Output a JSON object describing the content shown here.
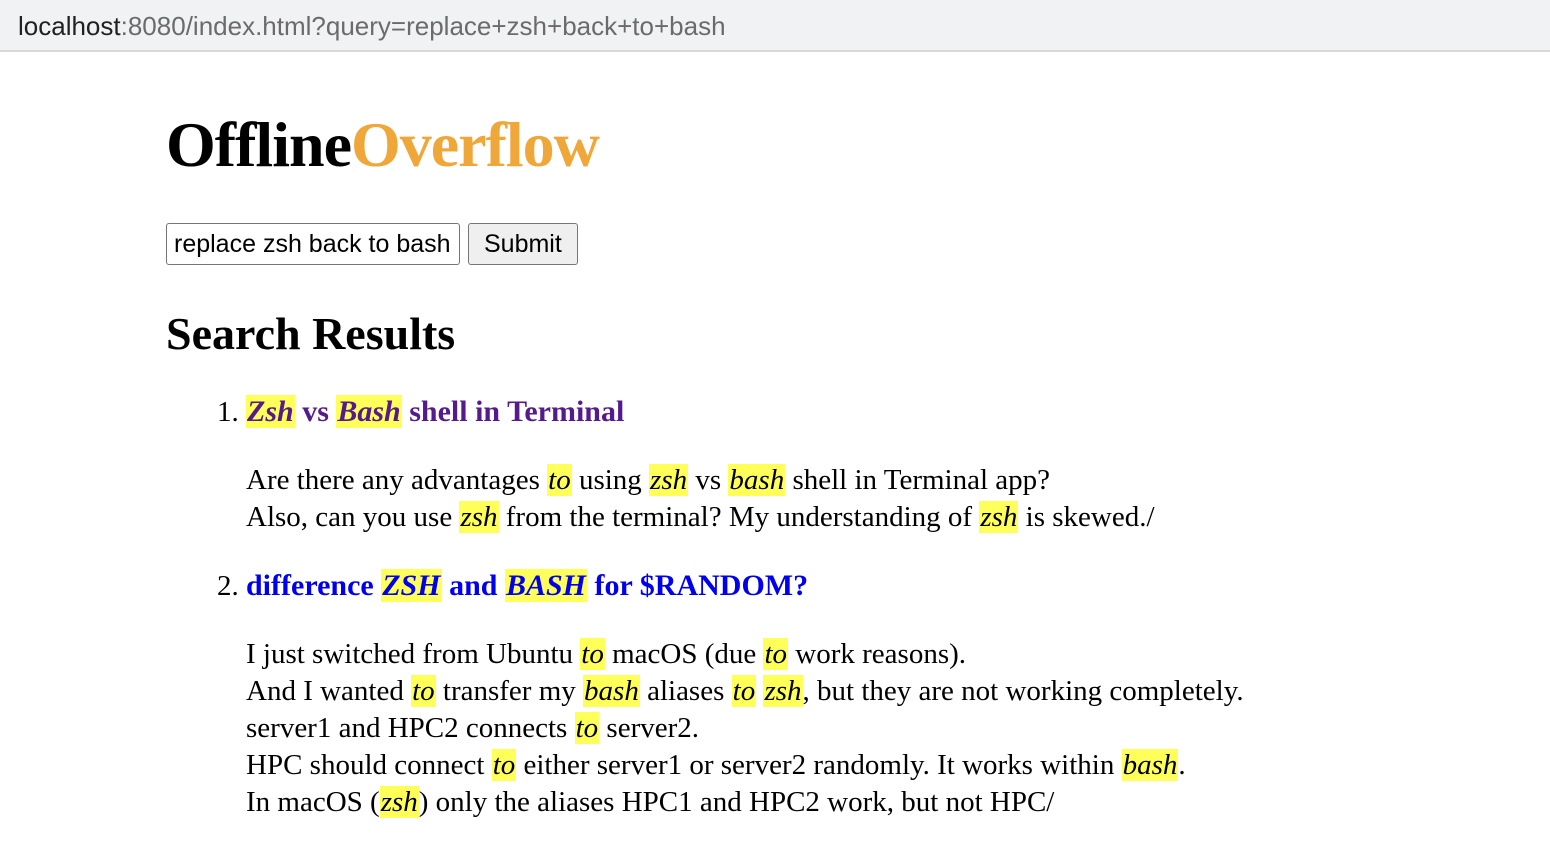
{
  "browser": {
    "url_host": "localhost",
    "url_rest": ":8080/index.html?query=replace+zsh+back+to+bash"
  },
  "logo": {
    "part1": "Offline",
    "part2": "Overflow"
  },
  "search": {
    "value": "replace zsh back to bash",
    "submit_label": "Submit"
  },
  "results_heading": "Search Results",
  "results": [
    {
      "number": "1",
      "title": [
        {
          "t": "Zsh",
          "hl": true
        },
        {
          "t": " vs "
        },
        {
          "t": "Bash",
          "hl": true
        },
        {
          "t": " shell in Terminal"
        }
      ],
      "snippet": [
        [
          {
            "t": "Are there any advantages "
          },
          {
            "t": "to",
            "hl": true
          },
          {
            "t": " using "
          },
          {
            "t": "zsh",
            "hl": true
          },
          {
            "t": " vs "
          },
          {
            "t": "bash",
            "hl": true
          },
          {
            "t": " shell in Terminal app?"
          }
        ],
        [
          {
            "t": "Also, can you use "
          },
          {
            "t": "zsh",
            "hl": true
          },
          {
            "t": " from the terminal? My understanding of "
          },
          {
            "t": "zsh",
            "hl": true
          },
          {
            "t": " is skewed./"
          }
        ]
      ]
    },
    {
      "number": "2",
      "title": [
        {
          "t": "difference "
        },
        {
          "t": "ZSH",
          "hl": true
        },
        {
          "t": " and "
        },
        {
          "t": "BASH",
          "hl": true
        },
        {
          "t": " for $RANDOM?"
        }
      ],
      "snippet": [
        [
          {
            "t": "I just switched from Ubuntu "
          },
          {
            "t": "to",
            "hl": true
          },
          {
            "t": " macOS (due "
          },
          {
            "t": "to",
            "hl": true
          },
          {
            "t": " work reasons)."
          }
        ],
        [
          {
            "t": "And I wanted "
          },
          {
            "t": "to",
            "hl": true
          },
          {
            "t": " transfer my "
          },
          {
            "t": "bash",
            "hl": true
          },
          {
            "t": " aliases "
          },
          {
            "t": "to",
            "hl": true
          },
          {
            "t": " "
          },
          {
            "t": "zsh",
            "hl": true
          },
          {
            "t": ", but they are not working completely."
          }
        ],
        [
          {
            "t": "server1 and HPC2 connects "
          },
          {
            "t": "to",
            "hl": true
          },
          {
            "t": " server2."
          }
        ],
        [
          {
            "t": "HPC should connect "
          },
          {
            "t": "to",
            "hl": true
          },
          {
            "t": " either server1 or server2 randomly. It works within "
          },
          {
            "t": "bash",
            "hl": true
          },
          {
            "t": "."
          }
        ],
        [
          {
            "t": "In macOS ("
          },
          {
            "t": "zsh",
            "hl": true
          },
          {
            "t": ") only the aliases HPC1 and HPC2 work, but not HPC/"
          }
        ]
      ]
    }
  ]
}
